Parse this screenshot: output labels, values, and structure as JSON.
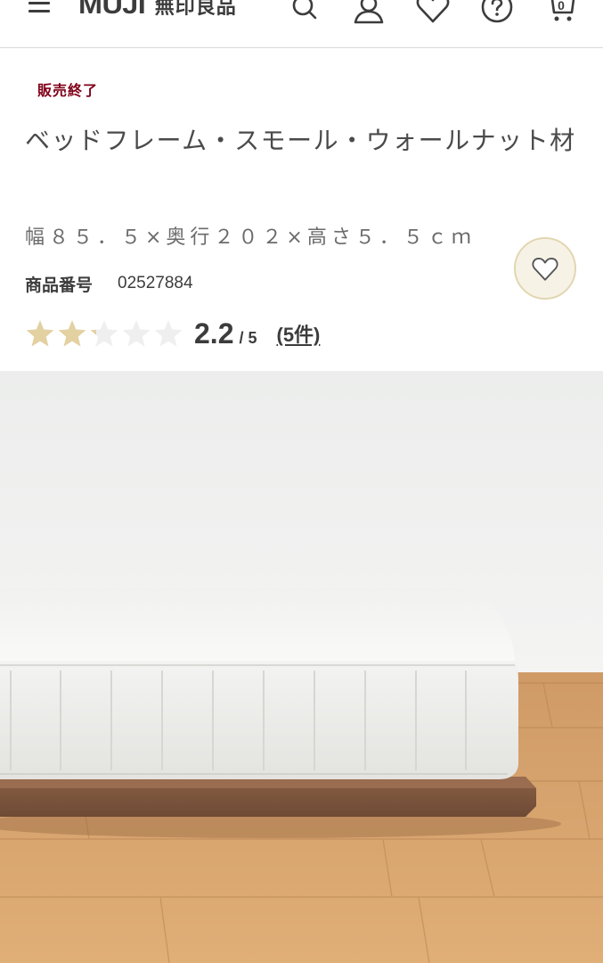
{
  "header": {
    "logo_en": "MUJI",
    "logo_jp": "無印良品",
    "cart_count": "0",
    "icons": [
      "menu-icon",
      "search-icon",
      "user-icon",
      "heart-icon",
      "help-icon",
      "cart-icon"
    ]
  },
  "product": {
    "status": "販売終了",
    "title": "ベッドフレーム・スモール・ウォールナット材",
    "size": "幅８５．５×奥行２０２×高さ５．５ｃｍ",
    "code_label": "商品番号",
    "code_value": "02527884",
    "rating": {
      "score": "2.2",
      "out_of": "/ 5",
      "value": 2.2,
      "max": 5,
      "reviews": "(5件)"
    }
  },
  "colors": {
    "status": "#7f0019",
    "star_filled": "#e3d1a2",
    "star_empty": "#efefef",
    "fav_bg": "#f6f2e6",
    "text": "#3c3c3c"
  },
  "image": {
    "subject": "walnut bed frame with white mattress on wooden floor"
  }
}
